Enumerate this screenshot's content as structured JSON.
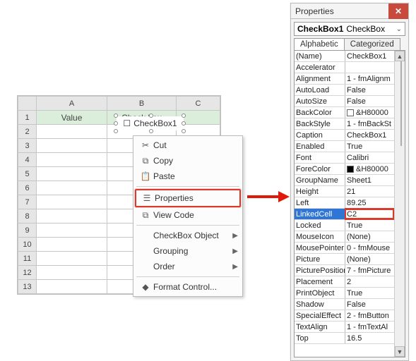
{
  "sheet": {
    "cols": [
      "A",
      "B",
      "C"
    ],
    "rows": [
      "1",
      "2",
      "3",
      "4",
      "5",
      "6",
      "7",
      "8",
      "9",
      "10",
      "11",
      "12",
      "13"
    ],
    "header": {
      "value": "Value",
      "checkbox": "Check box"
    },
    "checkbox_label": "CheckBox1"
  },
  "ctx": {
    "cut": "Cut",
    "copy": "Copy",
    "paste": "Paste",
    "properties": "Properties",
    "viewcode": "View Code",
    "cbobject": "CheckBox Object",
    "grouping": "Grouping",
    "order": "Order",
    "formatctrl": "Format Control..."
  },
  "prop": {
    "title": "Properties",
    "obj_name": "CheckBox1",
    "obj_type": "CheckBox",
    "tab_alpha": "Alphabetic",
    "tab_cat": "Categorized",
    "rows": [
      {
        "k": "(Name)",
        "v": "CheckBox1"
      },
      {
        "k": "Accelerator",
        "v": ""
      },
      {
        "k": "Alignment",
        "v": "1 - fmAlignm"
      },
      {
        "k": "AutoLoad",
        "v": "False"
      },
      {
        "k": "AutoSize",
        "v": "False"
      },
      {
        "k": "BackColor",
        "v": "&H80000",
        "swatch": "white"
      },
      {
        "k": "BackStyle",
        "v": "1 - fmBackSt"
      },
      {
        "k": "Caption",
        "v": "CheckBox1"
      },
      {
        "k": "Enabled",
        "v": "True"
      },
      {
        "k": "Font",
        "v": "Calibri"
      },
      {
        "k": "ForeColor",
        "v": "&H80000",
        "swatch": "black"
      },
      {
        "k": "GroupName",
        "v": "Sheet1"
      },
      {
        "k": "Height",
        "v": "21"
      },
      {
        "k": "Left",
        "v": "89.25"
      },
      {
        "k": "LinkedCell",
        "v": "C2",
        "selected": true
      },
      {
        "k": "Locked",
        "v": "True"
      },
      {
        "k": "MouseIcon",
        "v": "(None)"
      },
      {
        "k": "MousePointer",
        "v": "0 - fmMouse"
      },
      {
        "k": "Picture",
        "v": "(None)"
      },
      {
        "k": "PicturePosition",
        "v": "7 - fmPicture"
      },
      {
        "k": "Placement",
        "v": "2"
      },
      {
        "k": "PrintObject",
        "v": "True"
      },
      {
        "k": "Shadow",
        "v": "False"
      },
      {
        "k": "SpecialEffect",
        "v": "2 - fmButton"
      },
      {
        "k": "TextAlign",
        "v": "1 - fmTextAl"
      },
      {
        "k": "Top",
        "v": "16.5"
      }
    ]
  }
}
